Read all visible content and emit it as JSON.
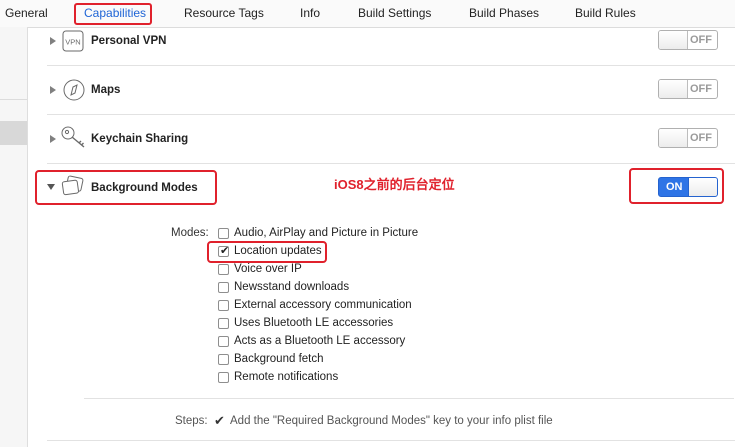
{
  "tabs": [
    {
      "label": "General"
    },
    {
      "label": "Capabilities"
    },
    {
      "label": "Resource Tags"
    },
    {
      "label": "Info"
    },
    {
      "label": "Build Settings"
    },
    {
      "label": "Build Phases"
    },
    {
      "label": "Build Rules"
    }
  ],
  "active_tab": "Capabilities",
  "capabilities": [
    {
      "name": "Personal VPN",
      "switch": "OFF",
      "icon": "vpn-icon",
      "icon_text": "VPN"
    },
    {
      "name": "Maps",
      "switch": "OFF",
      "icon": "compass-icon"
    },
    {
      "name": "Keychain Sharing",
      "switch": "OFF",
      "icon": "key-icon"
    },
    {
      "name": "Background Modes",
      "switch": "ON",
      "icon": "layers-icon"
    }
  ],
  "annotation_note": "iOS8之前的后台定位",
  "modes": {
    "label": "Modes:",
    "items": [
      {
        "label": "Audio, AirPlay and Picture in Picture",
        "checked": false
      },
      {
        "label": "Location updates",
        "checked": true
      },
      {
        "label": "Voice over IP",
        "checked": false
      },
      {
        "label": "Newsstand downloads",
        "checked": false
      },
      {
        "label": "External accessory communication",
        "checked": false
      },
      {
        "label": "Uses Bluetooth LE accessories",
        "checked": false
      },
      {
        "label": "Acts as a Bluetooth LE accessory",
        "checked": false
      },
      {
        "label": "Background fetch",
        "checked": false
      },
      {
        "label": "Remote notifications",
        "checked": false
      }
    ]
  },
  "steps": {
    "label": "Steps:",
    "text": "Add the \"Required Background Modes\" key to your info plist file"
  },
  "colors": {
    "accent": "#1e64d6",
    "annotation": "#e0212c",
    "switch_on": "#2e74e6"
  }
}
